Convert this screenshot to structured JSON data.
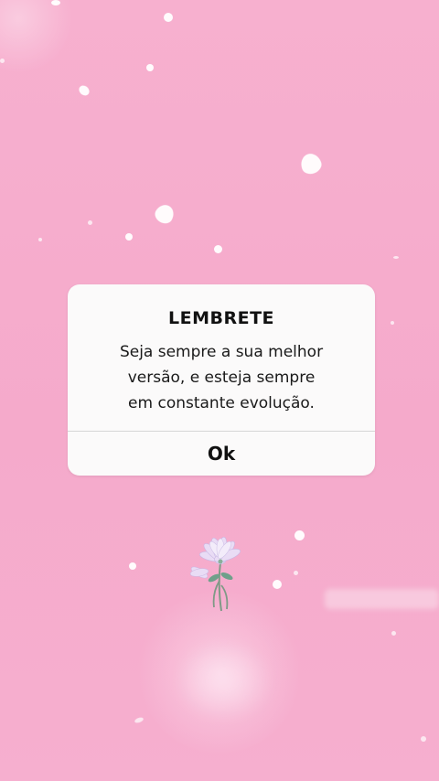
{
  "dialog": {
    "title": "LEMBRETE",
    "message": "Seja sempre a sua melhor\nversão, e esteja sempre\nem constante evolução.",
    "button_label": "Ok"
  },
  "colors": {
    "background": "#f6aece",
    "dialog_bg": "#fbfafa",
    "text": "#111111"
  },
  "icons": {
    "decoration": "flower-icon"
  }
}
